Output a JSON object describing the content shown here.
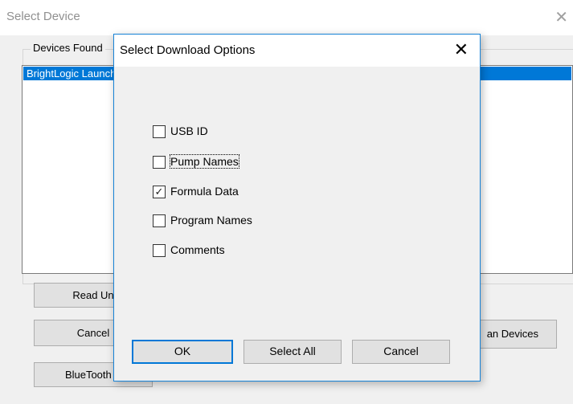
{
  "back_dialog": {
    "title": "Select Device",
    "close_glyph": "✕",
    "group_label": "Devices Found",
    "list_items": [
      "BrightLogic Launcher"
    ],
    "buttons": {
      "read": "Read Un",
      "cancel": "Cancel",
      "bluetooth": "BlueTooth S",
      "scan": "an Devices"
    }
  },
  "download_dialog": {
    "title": "Select Download Options",
    "close_glyph": "✕",
    "options": [
      {
        "label": "USB ID",
        "checked": false
      },
      {
        "label": "Pump Names",
        "checked": false
      },
      {
        "label": "Formula Data",
        "checked": true
      },
      {
        "label": "Program Names",
        "checked": false
      },
      {
        "label": "Comments",
        "checked": false
      }
    ],
    "check_glyph": "✓",
    "buttons": {
      "ok": "OK",
      "select_all": "Select All",
      "cancel": "Cancel"
    }
  },
  "colors": {
    "accent": "#0078d7",
    "dialog_border": "#1883d7",
    "window_bg": "#f0f0f0"
  }
}
